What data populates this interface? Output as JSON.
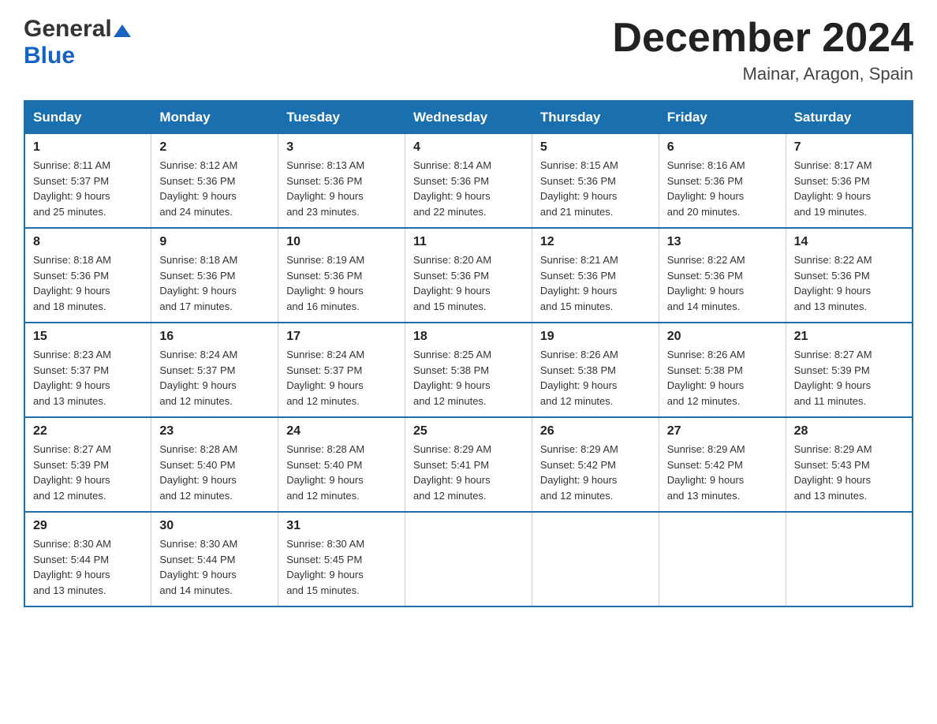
{
  "header": {
    "logo_general": "General",
    "logo_blue": "Blue",
    "month_title": "December 2024",
    "location": "Mainar, Aragon, Spain"
  },
  "weekdays": [
    "Sunday",
    "Monday",
    "Tuesday",
    "Wednesday",
    "Thursday",
    "Friday",
    "Saturday"
  ],
  "weeks": [
    [
      {
        "day": "1",
        "sunrise": "8:11 AM",
        "sunset": "5:37 PM",
        "daylight": "9 hours and 25 minutes."
      },
      {
        "day": "2",
        "sunrise": "8:12 AM",
        "sunset": "5:36 PM",
        "daylight": "9 hours and 24 minutes."
      },
      {
        "day": "3",
        "sunrise": "8:13 AM",
        "sunset": "5:36 PM",
        "daylight": "9 hours and 23 minutes."
      },
      {
        "day": "4",
        "sunrise": "8:14 AM",
        "sunset": "5:36 PM",
        "daylight": "9 hours and 22 minutes."
      },
      {
        "day": "5",
        "sunrise": "8:15 AM",
        "sunset": "5:36 PM",
        "daylight": "9 hours and 21 minutes."
      },
      {
        "day": "6",
        "sunrise": "8:16 AM",
        "sunset": "5:36 PM",
        "daylight": "9 hours and 20 minutes."
      },
      {
        "day": "7",
        "sunrise": "8:17 AM",
        "sunset": "5:36 PM",
        "daylight": "9 hours and 19 minutes."
      }
    ],
    [
      {
        "day": "8",
        "sunrise": "8:18 AM",
        "sunset": "5:36 PM",
        "daylight": "9 hours and 18 minutes."
      },
      {
        "day": "9",
        "sunrise": "8:18 AM",
        "sunset": "5:36 PM",
        "daylight": "9 hours and 17 minutes."
      },
      {
        "day": "10",
        "sunrise": "8:19 AM",
        "sunset": "5:36 PM",
        "daylight": "9 hours and 16 minutes."
      },
      {
        "day": "11",
        "sunrise": "8:20 AM",
        "sunset": "5:36 PM",
        "daylight": "9 hours and 15 minutes."
      },
      {
        "day": "12",
        "sunrise": "8:21 AM",
        "sunset": "5:36 PM",
        "daylight": "9 hours and 15 minutes."
      },
      {
        "day": "13",
        "sunrise": "8:22 AM",
        "sunset": "5:36 PM",
        "daylight": "9 hours and 14 minutes."
      },
      {
        "day": "14",
        "sunrise": "8:22 AM",
        "sunset": "5:36 PM",
        "daylight": "9 hours and 13 minutes."
      }
    ],
    [
      {
        "day": "15",
        "sunrise": "8:23 AM",
        "sunset": "5:37 PM",
        "daylight": "9 hours and 13 minutes."
      },
      {
        "day": "16",
        "sunrise": "8:24 AM",
        "sunset": "5:37 PM",
        "daylight": "9 hours and 12 minutes."
      },
      {
        "day": "17",
        "sunrise": "8:24 AM",
        "sunset": "5:37 PM",
        "daylight": "9 hours and 12 minutes."
      },
      {
        "day": "18",
        "sunrise": "8:25 AM",
        "sunset": "5:38 PM",
        "daylight": "9 hours and 12 minutes."
      },
      {
        "day": "19",
        "sunrise": "8:26 AM",
        "sunset": "5:38 PM",
        "daylight": "9 hours and 12 minutes."
      },
      {
        "day": "20",
        "sunrise": "8:26 AM",
        "sunset": "5:38 PM",
        "daylight": "9 hours and 12 minutes."
      },
      {
        "day": "21",
        "sunrise": "8:27 AM",
        "sunset": "5:39 PM",
        "daylight": "9 hours and 11 minutes."
      }
    ],
    [
      {
        "day": "22",
        "sunrise": "8:27 AM",
        "sunset": "5:39 PM",
        "daylight": "9 hours and 12 minutes."
      },
      {
        "day": "23",
        "sunrise": "8:28 AM",
        "sunset": "5:40 PM",
        "daylight": "9 hours and 12 minutes."
      },
      {
        "day": "24",
        "sunrise": "8:28 AM",
        "sunset": "5:40 PM",
        "daylight": "9 hours and 12 minutes."
      },
      {
        "day": "25",
        "sunrise": "8:29 AM",
        "sunset": "5:41 PM",
        "daylight": "9 hours and 12 minutes."
      },
      {
        "day": "26",
        "sunrise": "8:29 AM",
        "sunset": "5:42 PM",
        "daylight": "9 hours and 12 minutes."
      },
      {
        "day": "27",
        "sunrise": "8:29 AM",
        "sunset": "5:42 PM",
        "daylight": "9 hours and 13 minutes."
      },
      {
        "day": "28",
        "sunrise": "8:29 AM",
        "sunset": "5:43 PM",
        "daylight": "9 hours and 13 minutes."
      }
    ],
    [
      {
        "day": "29",
        "sunrise": "8:30 AM",
        "sunset": "5:44 PM",
        "daylight": "9 hours and 13 minutes."
      },
      {
        "day": "30",
        "sunrise": "8:30 AM",
        "sunset": "5:44 PM",
        "daylight": "9 hours and 14 minutes."
      },
      {
        "day": "31",
        "sunrise": "8:30 AM",
        "sunset": "5:45 PM",
        "daylight": "9 hours and 15 minutes."
      },
      null,
      null,
      null,
      null
    ]
  ],
  "labels": {
    "sunrise": "Sunrise:",
    "sunset": "Sunset:",
    "daylight": "Daylight:"
  }
}
